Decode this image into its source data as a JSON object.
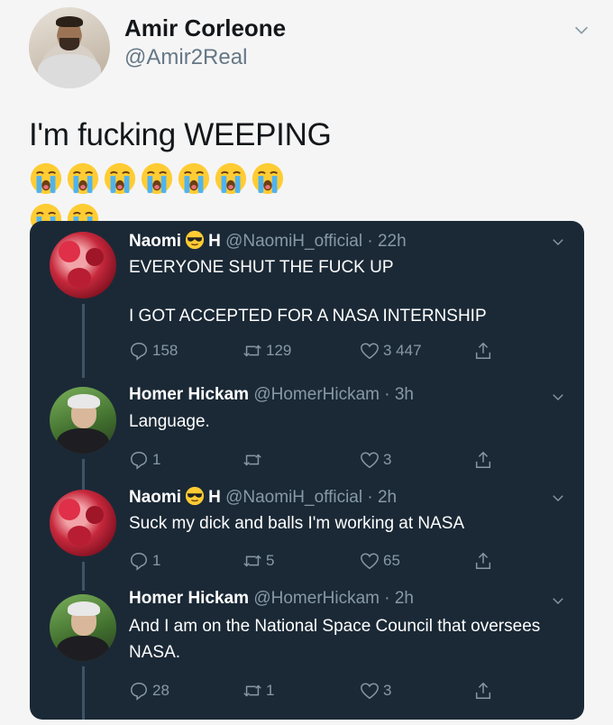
{
  "outer": {
    "name": "Amir Corleone",
    "handle": "@Amir2Real",
    "text": "I'm fucking WEEPING",
    "emoji_icon": "loudly-crying-face"
  },
  "tweets": [
    {
      "name_first": "Naomi",
      "name_last": "H",
      "meta": "@NaomiH_official · 22h",
      "text_line1": "EVERYONE SHUT THE FUCK UP",
      "text_line2": "I GOT ACCEPTED FOR A NASA INTERNSHIP",
      "replies": "158",
      "retweets": "129",
      "likes": "3 447"
    },
    {
      "name": "Homer Hickam",
      "meta": "@HomerHickam · 3h",
      "text": "Language.",
      "replies": "1",
      "retweets": "",
      "likes": "3"
    },
    {
      "name_first": "Naomi",
      "name_last": "H",
      "meta": "@NaomiH_official · 2h",
      "text": "Suck my dick and balls I'm working at NASA",
      "replies": "1",
      "retweets": "5",
      "likes": "65"
    },
    {
      "name": "Homer Hickam",
      "meta": "@HomerHickam · 2h",
      "text": "And I am on the National Space Council that oversees NASA.",
      "replies": "28",
      "retweets": "1",
      "likes": "3"
    }
  ]
}
